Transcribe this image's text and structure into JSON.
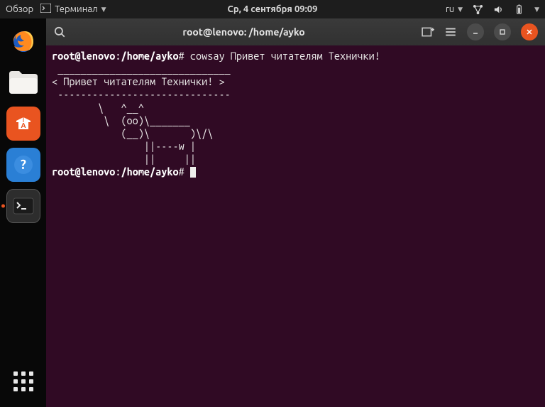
{
  "top_panel": {
    "overview": "Обзор",
    "app_menu": "Терминал",
    "clock": "Ср, 4 сентября  09:09",
    "input_lang": "ru"
  },
  "dock": {
    "apps": [
      {
        "name": "firefox",
        "running": false
      },
      {
        "name": "files",
        "running": false
      },
      {
        "name": "software",
        "running": false
      },
      {
        "name": "help",
        "running": false
      },
      {
        "name": "terminal",
        "running": true
      }
    ]
  },
  "window": {
    "title": "root@lenovo: /home/ayko"
  },
  "terminal": {
    "prompt_user": "root@lenovo",
    "prompt_path": "/home/ayko",
    "prompt_suffix": "#",
    "command": "cowsay Привет читателям Технички!",
    "output_lines": [
      " ______________________________ ",
      "< Привет читателям Технички! >",
      " ------------------------------ ",
      "        \\   ^__^",
      "         \\  (oo)\\_______",
      "            (__)\\       )\\/\\",
      "                ||----w |",
      "                ||     ||"
    ]
  }
}
